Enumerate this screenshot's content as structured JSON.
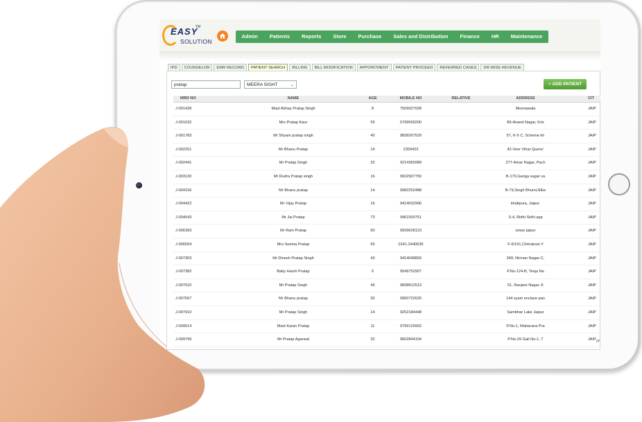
{
  "app": {
    "logo": {
      "line1": "EASY",
      "tm": "TM",
      "line2": "SOLUTION"
    },
    "colors": {
      "nav_green": "#4aa45e",
      "accent_orange": "#f58220",
      "add_button_green": "#5aa83c"
    }
  },
  "nav": {
    "items": [
      {
        "label": "Admin"
      },
      {
        "label": "Patients"
      },
      {
        "label": "Reports"
      },
      {
        "label": "Store"
      },
      {
        "label": "Purchase"
      },
      {
        "label": "Sales and Distribution"
      },
      {
        "label": "Finance"
      },
      {
        "label": "HR"
      },
      {
        "label": "Maintenance"
      }
    ]
  },
  "tabs": {
    "items": [
      {
        "label": "IPD"
      },
      {
        "label": "COUNSELOR"
      },
      {
        "label": "EMR RECORD"
      },
      {
        "label": "PATIENT SEARCH"
      },
      {
        "label": "BILLING"
      },
      {
        "label": "BILL MODIFICATION"
      },
      {
        "label": "APPOINTMENT"
      },
      {
        "label": "PATIENT PROCEED"
      },
      {
        "label": "REFERRED CASES"
      },
      {
        "label": "DR.WISE REVENUE"
      }
    ],
    "active_index": 3
  },
  "search": {
    "value": "pratap",
    "clinic": "MEERA SIGHT",
    "add_label": "+ ADD PATIENT"
  },
  "table": {
    "headers": {
      "mrd": "MRD NO",
      "name": "NAME",
      "age": "AGE",
      "mobile": "MOBILE NO",
      "relative": "RELATIVE",
      "address": "ADDRESS",
      "city": "CIT"
    },
    "rows": [
      {
        "mrd": "J-001439",
        "name": "Mast Abhay Pratap Singh",
        "age": "8",
        "mobile": "7509927028",
        "relative": "",
        "address": "Meenawala",
        "city": "JAIP"
      },
      {
        "mrd": "J-001632",
        "name": "Mrs Pratap Kaur",
        "age": "55",
        "mobile": "5799590200",
        "relative": "",
        "address": "89-Anand Nagar, Kris",
        "city": "JAIP"
      },
      {
        "mrd": "J-001783",
        "name": "Mr Shyam pratap singh",
        "age": "40",
        "mobile": "9828267529",
        "relative": "",
        "address": "57, K-5 C, Scheme kh",
        "city": "JAIP"
      },
      {
        "mrd": "J-002251",
        "name": "Mr Bhanu Pratap",
        "age": "14",
        "mobile": "2359423",
        "relative": "",
        "address": "42-Veer Vihar Quenc'",
        "city": "JAIP"
      },
      {
        "mrd": "J-002441",
        "name": "Mr Pratap Singh",
        "age": "32",
        "mobile": "9214365089",
        "relative": "",
        "address": "277-Amar Nagar, Pach",
        "city": "JAIP"
      },
      {
        "mrd": "J-003130",
        "name": "Mr Rudra Pratap singh",
        "age": "16",
        "mobile": "9602907750",
        "relative": "",
        "address": "B-179,Ganga sagar va",
        "city": "JAIP"
      },
      {
        "mrd": "J-004156",
        "name": "Mr Bhanu pratap",
        "age": "14",
        "mobile": "9982252488",
        "relative": "",
        "address": "B-79,Singh Bhumi,NEw",
        "city": "JAIP"
      },
      {
        "mrd": "J-004422",
        "name": "Mr Vijay Pratap",
        "age": "16",
        "mobile": "9414032906",
        "relative": "",
        "address": "khatipura, Jaipur.",
        "city": "JAIP"
      },
      {
        "mrd": "J-004543",
        "name": "Mr Jai Pratap",
        "age": "73",
        "mobile": "9461500751",
        "relative": "",
        "address": "S-4, Ridhi Sidhi app",
        "city": "JAIP"
      },
      {
        "mrd": "J-006393",
        "name": "Mr Ram Pratap",
        "age": "60",
        "mobile": "9929628123",
        "relative": "",
        "address": "sirsar jaipur",
        "city": "JAIP"
      },
      {
        "mrd": "J-006554",
        "name": "Mrs Seema Pratap",
        "age": "55",
        "mobile": "0141-2440639",
        "relative": "",
        "address": "F-6/191,Chitrakoot V",
        "city": "JAIP"
      },
      {
        "mrd": "J-007303",
        "name": "Mr Dinesh Pratap Singh",
        "age": "43",
        "mobile": "9414048893",
        "relative": "",
        "address": "349, Nirman Nagar-C,",
        "city": "JAIP"
      },
      {
        "mrd": "J-007382",
        "name": "Baby Harsh Pratap",
        "age": "6",
        "mobile": "9549752907",
        "relative": "",
        "address": "P.No-124-B, Teeja Na",
        "city": "JAIP"
      },
      {
        "mrd": "J-007510",
        "name": "Mr Pratap Singh",
        "age": "49",
        "mobile": "9828812513",
        "relative": "",
        "address": "51, Ranjeet Nagar, K",
        "city": "JAIP"
      },
      {
        "mrd": "J-007567",
        "name": "Mr Bhanu pratap",
        "age": "30",
        "mobile": "9950722620",
        "relative": "",
        "address": "144 syam enclave pan",
        "city": "JAIP"
      },
      {
        "mrd": "J-007910",
        "name": "Mr Pratap Singh",
        "age": "14",
        "mobile": "9252184448",
        "relative": "",
        "address": "Sambhar Lake Jaipur",
        "city": "JAIP"
      },
      {
        "mrd": "J-009514",
        "name": "Mast Karan Pratap",
        "age": "11",
        "mobile": "9799120902",
        "relative": "",
        "address": "P.No-1, Maharana Pra",
        "city": "JAIP"
      },
      {
        "mrd": "J-009799",
        "name": "Mr Pratap Agarwal",
        "age": "32",
        "mobile": "9602844194",
        "relative": "",
        "address": "P.No-29 Gali No-1, T",
        "city": "JAIP"
      }
    ],
    "footer_fragment": "IP"
  }
}
